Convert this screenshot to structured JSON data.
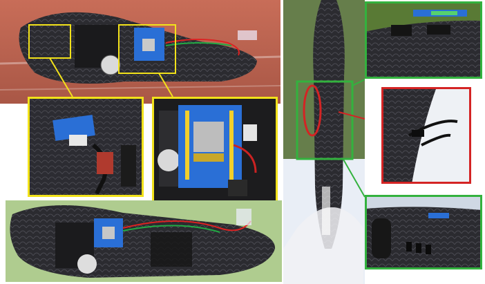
{
  "figure": {
    "panels": [
      {
        "id": "left-top-photo",
        "subject": "drone-internal-frame-side-view"
      },
      {
        "id": "left-bottom-photo",
        "subject": "drone-internal-frame-top-view"
      },
      {
        "id": "right-photo",
        "subject": "drone-underside-frame"
      },
      {
        "id": "zoom-sensor-module",
        "callout": "yellow"
      },
      {
        "id": "zoom-esp-board",
        "callout": "yellow"
      },
      {
        "id": "zoom-top-sensor-strip",
        "callout": "green"
      },
      {
        "id": "zoom-cable-exit",
        "callout": "red"
      },
      {
        "id": "zoom-side-ports",
        "callout": "green"
      }
    ],
    "colors": {
      "yellow_callout": "#f2e21a",
      "green_callout": "#33b23e",
      "red_callout": "#d42424",
      "board_blue": "#2a6fd6",
      "foam_dark": "#2b2b30"
    }
  }
}
